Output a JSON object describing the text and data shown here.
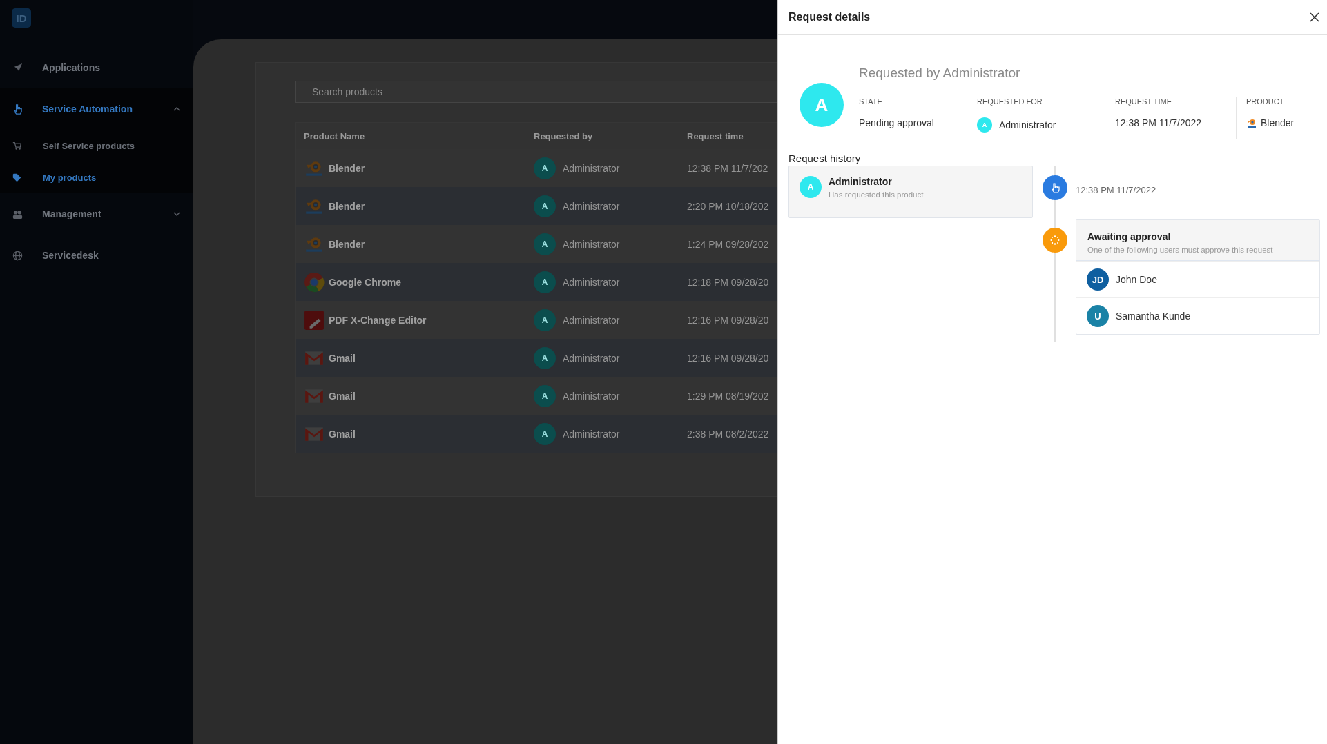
{
  "sidebar": {
    "logo": "ID",
    "items": [
      {
        "label": "Applications",
        "selected": false
      },
      {
        "label": "Service Automation",
        "selected": true,
        "expanded": true,
        "children": [
          {
            "label": "Self Service products",
            "selected": false
          },
          {
            "label": "My products",
            "selected": true
          }
        ]
      },
      {
        "label": "Management",
        "selected": false,
        "expanded": false
      },
      {
        "label": "Servicedesk",
        "selected": false
      }
    ]
  },
  "products": {
    "search": {
      "placeholder": "Search products"
    },
    "columns": [
      "Product Name",
      "Requested by",
      "Request time"
    ],
    "rows": [
      {
        "product": "Blender",
        "kind": "blender",
        "requester_initial": "A",
        "requester": "Administrator",
        "time": "12:38 PM 11/7/202"
      },
      {
        "product": "Blender",
        "kind": "blender",
        "requester_initial": "A",
        "requester": "Administrator",
        "time": "2:20 PM 10/18/202"
      },
      {
        "product": "Blender",
        "kind": "blender",
        "requester_initial": "A",
        "requester": "Administrator",
        "time": "1:24 PM 09/28/202"
      },
      {
        "product": "Google Chrome",
        "kind": "chrome",
        "requester_initial": "A",
        "requester": "Administrator",
        "time": "12:18 PM 09/28/20"
      },
      {
        "product": "PDF X-Change Editor",
        "kind": "pdf",
        "requester_initial": "A",
        "requester": "Administrator",
        "time": "12:16 PM 09/28/20"
      },
      {
        "product": "Gmail",
        "kind": "gmail",
        "requester_initial": "A",
        "requester": "Administrator",
        "time": "12:16 PM 09/28/20"
      },
      {
        "product": "Gmail",
        "kind": "gmail",
        "requester_initial": "A",
        "requester": "Administrator",
        "time": "1:29 PM 08/19/202"
      },
      {
        "product": "Gmail",
        "kind": "gmail",
        "requester_initial": "A",
        "requester": "Administrator",
        "time": "2:38 PM 08/2/2022"
      }
    ]
  },
  "request_panel": {
    "title": "Request details",
    "avatar": "A",
    "heading": "Requested by Administrator",
    "fields": [
      {
        "kind": "text",
        "label": "STATE",
        "value": "Pending approval"
      },
      {
        "kind": "user",
        "label": "REQUESTED FOR",
        "avatar": "A",
        "value": "Administrator"
      },
      {
        "kind": "text",
        "label": "REQUEST TIME",
        "value": "12:38 PM 11/7/2022"
      },
      {
        "kind": "product",
        "label": "PRODUCT",
        "value": "Blender"
      }
    ],
    "history": {
      "title": "Request history",
      "events": [
        {
          "kind": "requested",
          "avatar": "A",
          "name": "Administrator",
          "note": "Has requested this product",
          "time": "12:38 PM 11/7/2022"
        },
        {
          "kind": "approval",
          "title": "Awaiting approval",
          "note": "One of the following users must approve this request",
          "approvers": [
            {
              "initials": "JD",
              "name": "John Doe",
              "color": "#0f5fa0"
            },
            {
              "initials": "U",
              "name": "Samantha Kunde",
              "color": "#1a82a6"
            }
          ]
        }
      ]
    }
  }
}
